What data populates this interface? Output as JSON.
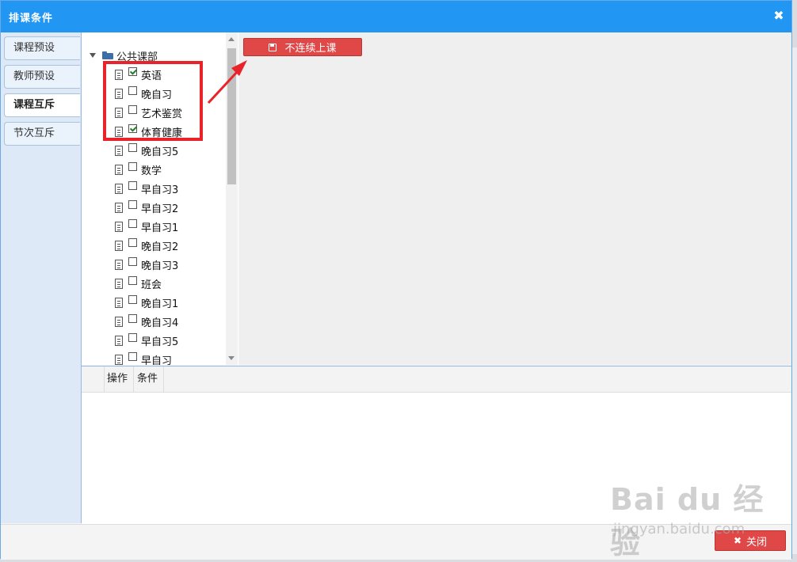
{
  "dialog": {
    "title": "排课条件"
  },
  "sidebar": {
    "tabs": [
      {
        "label": "课程预设",
        "active": false
      },
      {
        "label": "教师预设",
        "active": false
      },
      {
        "label": "课程互斥",
        "active": true
      },
      {
        "label": "节次互斥",
        "active": false
      }
    ]
  },
  "tree": {
    "root": "公共课部",
    "nodes": [
      {
        "label": "英语",
        "checked": true
      },
      {
        "label": "晚自习",
        "checked": false
      },
      {
        "label": "艺术鉴赏",
        "checked": false
      },
      {
        "label": "体育健康",
        "checked": true
      },
      {
        "label": "晚自习5",
        "checked": false
      },
      {
        "label": "数学",
        "checked": false
      },
      {
        "label": "早自习3",
        "checked": false
      },
      {
        "label": "早自习2",
        "checked": false
      },
      {
        "label": "早自习1",
        "checked": false
      },
      {
        "label": "晚自习2",
        "checked": false
      },
      {
        "label": "晚自习3",
        "checked": false
      },
      {
        "label": "班会",
        "checked": false
      },
      {
        "label": "晚自习1",
        "checked": false
      },
      {
        "label": "晚自习4",
        "checked": false
      },
      {
        "label": "早自习5",
        "checked": false
      },
      {
        "label": "早自习",
        "checked": false
      }
    ]
  },
  "toolbar": {
    "action_label": "不连续上课"
  },
  "grid": {
    "columns": [
      "操作",
      "条件"
    ]
  },
  "footer": {
    "close_label": "关闭"
  },
  "watermark": {
    "main": "Bai du 经验",
    "sub": "jingyan.baidu.com"
  },
  "colors": {
    "titlebar": "#2196f3",
    "danger": "#e04848",
    "highlight": "#e8242a"
  }
}
